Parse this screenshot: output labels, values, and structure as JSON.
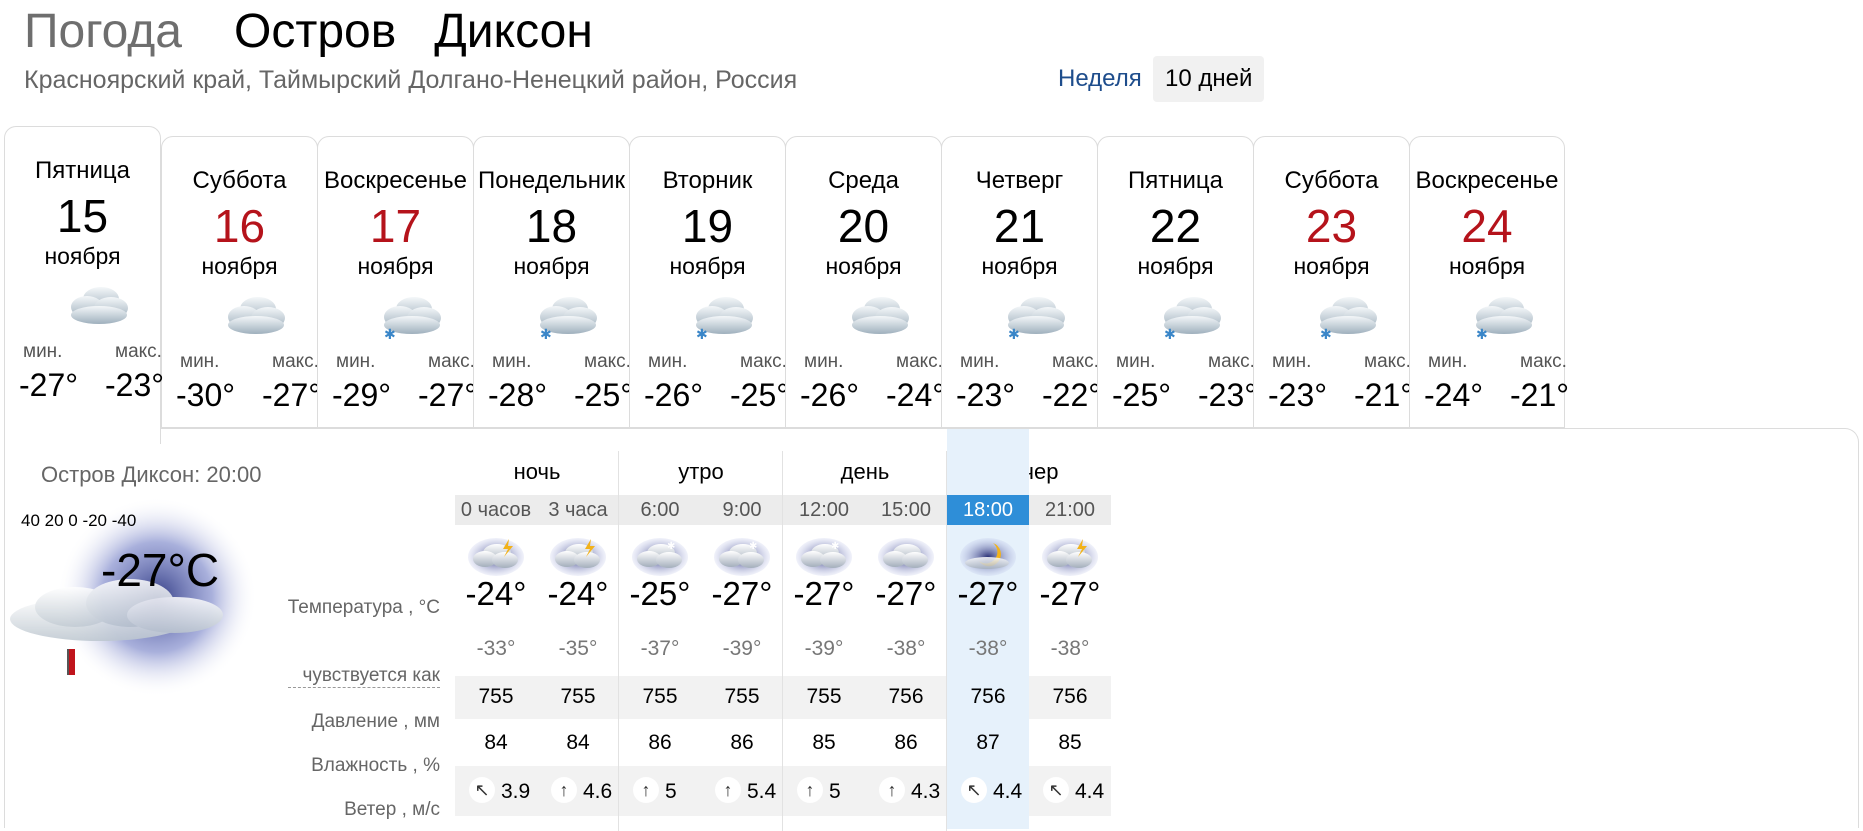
{
  "header": {
    "label": "Погода",
    "city_part1": "Остров",
    "city_part2": "Диксон",
    "region": "Красноярский край, Таймырский Долгано-Ненецкий район, Россия",
    "period_week": "Неделя",
    "period_ten": "10 дней"
  },
  "days": [
    {
      "name": "Пятница",
      "num": "15",
      "month": "ноября",
      "min_label": "мин.",
      "max_label": "макс.",
      "min": "-27°",
      "max": "-23°",
      "weekend": false,
      "icon": "cloudy-icon"
    },
    {
      "name": "Суббота",
      "num": "16",
      "month": "ноября",
      "min_label": "мин.",
      "max_label": "макс.",
      "min": "-30°",
      "max": "-27°",
      "weekend": true,
      "icon": "cloudy-icon"
    },
    {
      "name": "Воскресенье",
      "num": "17",
      "month": "ноября",
      "min_label": "мин.",
      "max_label": "макс.",
      "min": "-29°",
      "max": "-27°",
      "weekend": true,
      "icon": "cloudy-snow-icon"
    },
    {
      "name": "Понедельник",
      "num": "18",
      "month": "ноября",
      "min_label": "мин.",
      "max_label": "макс.",
      "min": "-28°",
      "max": "-25°",
      "weekend": false,
      "icon": "cloudy-snow-icon"
    },
    {
      "name": "Вторник",
      "num": "19",
      "month": "ноября",
      "min_label": "мин.",
      "max_label": "макс.",
      "min": "-26°",
      "max": "-25°",
      "weekend": false,
      "icon": "cloudy-snow-icon"
    },
    {
      "name": "Среда",
      "num": "20",
      "month": "ноября",
      "min_label": "мин.",
      "max_label": "макс.",
      "min": "-26°",
      "max": "-24°",
      "weekend": false,
      "icon": "cloudy-icon"
    },
    {
      "name": "Четверг",
      "num": "21",
      "month": "ноября",
      "min_label": "мин.",
      "max_label": "макс.",
      "min": "-23°",
      "max": "-22°",
      "weekend": false,
      "icon": "cloudy-snow-icon"
    },
    {
      "name": "Пятница",
      "num": "22",
      "month": "ноября",
      "min_label": "мин.",
      "max_label": "макс.",
      "min": "-25°",
      "max": "-23°",
      "weekend": false,
      "icon": "cloudy-snow-icon"
    },
    {
      "name": "Суббота",
      "num": "23",
      "month": "ноября",
      "min_label": "мин.",
      "max_label": "макс.",
      "min": "-23°",
      "max": "-21°",
      "weekend": true,
      "icon": "cloudy-snow-icon"
    },
    {
      "name": "Воскресенье",
      "num": "24",
      "month": "ноября",
      "min_label": "мин.",
      "max_label": "макс.",
      "min": "-24°",
      "max": "-21°",
      "weekend": true,
      "icon": "cloudy-snow-icon"
    }
  ],
  "current": {
    "location_time": "Остров Диксон: 20:00",
    "scale": "40 20 0 -20 -40",
    "temp": "-27°C",
    "icon": "night-cloudy-moon-icon"
  },
  "labels": {
    "temperature": "Температура , °C",
    "feels_like": "чувствуется как",
    "pressure": "Давление , мм",
    "humidity": "Влажность , %",
    "wind": "Ветер , м/с"
  },
  "periods": [
    "ночь",
    "утро",
    "день",
    "вечер"
  ],
  "hours": [
    {
      "time": "0 часов",
      "temp": "-24°",
      "feel": "-33°",
      "pressure": "755",
      "humidity": "84",
      "wind_dir": "↖",
      "wind": "3.9",
      "icon": "night-cloudy-lightning-icon"
    },
    {
      "time": "3 часа",
      "temp": "-24°",
      "feel": "-35°",
      "pressure": "755",
      "humidity": "84",
      "wind_dir": "↑",
      "wind": "4.6",
      "icon": "night-cloudy-lightning-icon"
    },
    {
      "time": "6:00",
      "temp": "-25°",
      "feel": "-37°",
      "pressure": "755",
      "humidity": "86",
      "wind_dir": "↑",
      "wind": "5",
      "icon": "night-cloudy-snow-icon"
    },
    {
      "time": "9:00",
      "temp": "-27°",
      "feel": "-39°",
      "pressure": "755",
      "humidity": "86",
      "wind_dir": "↑",
      "wind": "5.4",
      "icon": "night-cloudy-snow-icon"
    },
    {
      "time": "12:00",
      "temp": "-27°",
      "feel": "-39°",
      "pressure": "755",
      "humidity": "85",
      "wind_dir": "↑",
      "wind": "5",
      "icon": "night-cloudy-snow-icon"
    },
    {
      "time": "15:00",
      "temp": "-27°",
      "feel": "-38°",
      "pressure": "756",
      "humidity": "86",
      "wind_dir": "↑",
      "wind": "4.3",
      "icon": "night-cloudy-icon"
    },
    {
      "time": "18:00",
      "temp": "-27°",
      "feel": "-38°",
      "pressure": "756",
      "humidity": "87",
      "wind_dir": "↖",
      "wind": "4.4",
      "icon": "night-moon-cloudy-icon",
      "current": true
    },
    {
      "time": "21:00",
      "temp": "-27°",
      "feel": "-38°",
      "pressure": "756",
      "humidity": "85",
      "wind_dir": "↖",
      "wind": "4.4",
      "icon": "night-cloudy-lightning-icon"
    }
  ],
  "colors": {
    "weekend": "#b5131b",
    "link": "#1e4d8c",
    "current_hour": "#2e8ed8",
    "current_col": "#e6f1fb"
  }
}
